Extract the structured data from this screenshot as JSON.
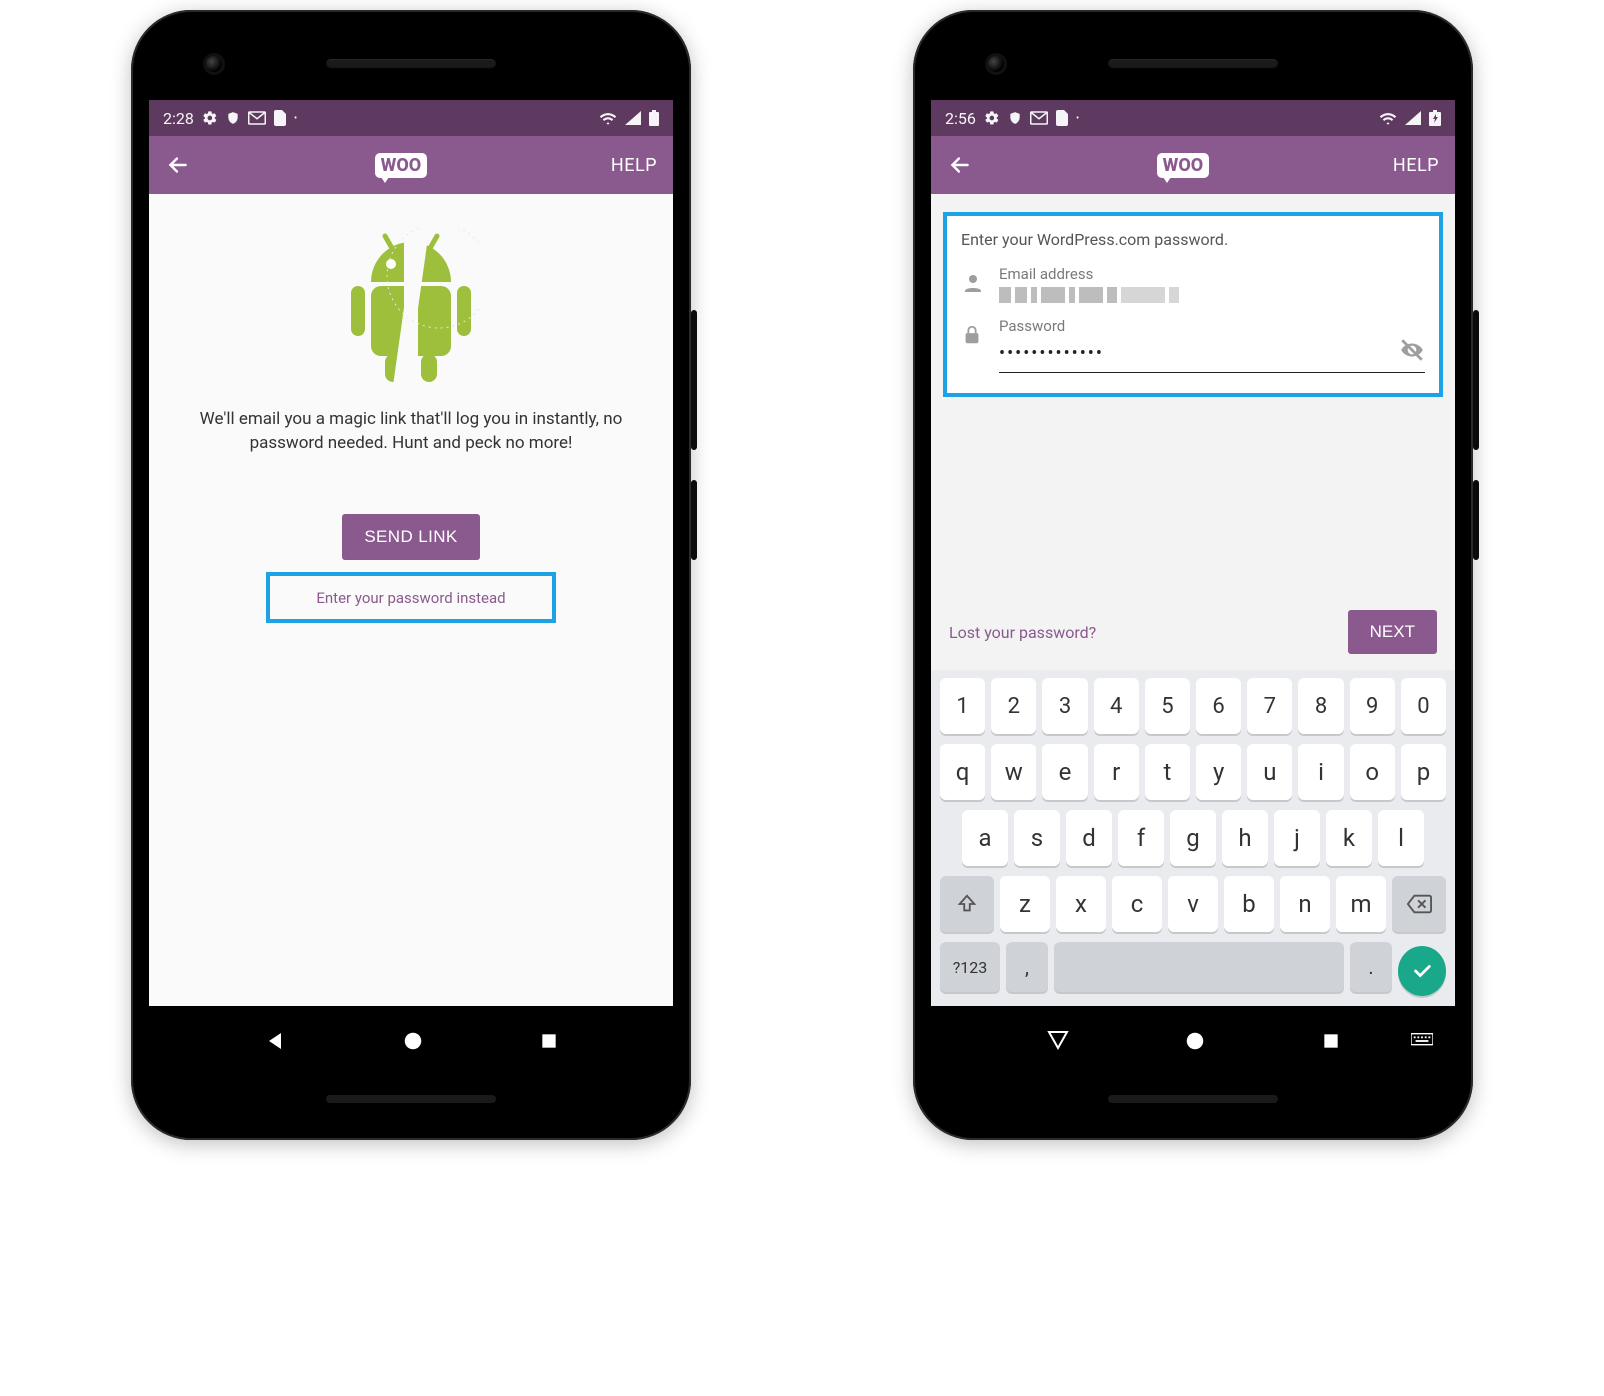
{
  "phone1": {
    "status": {
      "time": "2:28",
      "icons_left": [
        "gear-icon",
        "shield-icon",
        "mail-icon",
        "sim-icon",
        "dot-icon"
      ],
      "icons_right": [
        "wifi-icon",
        "signal-icon",
        "battery-icon"
      ]
    },
    "appbar": {
      "logo_text": "WOO",
      "help": "HELP"
    },
    "magic_text": "We'll email you a magic link that'll log you in instantly, no password needed. Hunt and peck no more!",
    "send_link_label": "SEND LINK",
    "password_instead_label": "Enter your password instead"
  },
  "phone2": {
    "status": {
      "time": "2:56",
      "icons_left": [
        "gear-icon",
        "shield-icon",
        "mail-icon",
        "sim-icon",
        "dot-icon"
      ],
      "icons_right": [
        "wifi-icon",
        "signal-icon",
        "battery-charging-icon"
      ]
    },
    "appbar": {
      "logo_text": "WOO",
      "help": "HELP"
    },
    "form": {
      "prompt": "Enter your WordPress.com password.",
      "email_label": "Email address",
      "email_value_redacted": true,
      "password_label": "Password",
      "password_value": "•••••••••••••"
    },
    "footer": {
      "lost_password": "Lost your password?",
      "next_label": "NEXT"
    },
    "keyboard": {
      "row_num": [
        "1",
        "2",
        "3",
        "4",
        "5",
        "6",
        "7",
        "8",
        "9",
        "0"
      ],
      "row1": [
        "q",
        "w",
        "e",
        "r",
        "t",
        "y",
        "u",
        "i",
        "o",
        "p"
      ],
      "row2": [
        "a",
        "s",
        "d",
        "f",
        "g",
        "h",
        "j",
        "k",
        "l"
      ],
      "row3": [
        "z",
        "x",
        "c",
        "v",
        "b",
        "n",
        "m"
      ],
      "sym_key": "?123",
      "comma_key": ",",
      "period_key": "."
    }
  }
}
